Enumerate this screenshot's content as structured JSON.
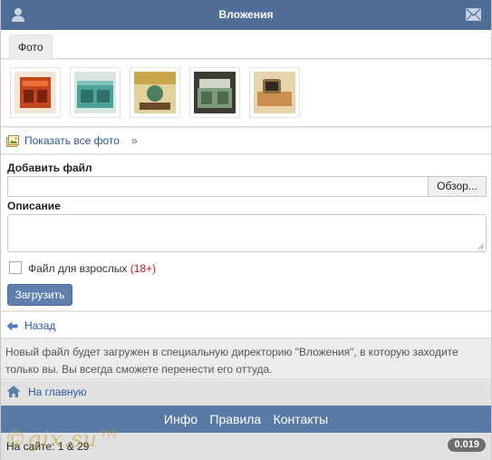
{
  "header": {
    "title": "Вложения",
    "left_icon": "user-icon",
    "right_icon": "mail-icon",
    "bg_color": "#4f6d97"
  },
  "tabs": [
    {
      "label": "Фото",
      "active": true
    }
  ],
  "thumbnails": [
    {
      "alt": "photo-1",
      "colors": [
        "#c4461f",
        "#e8743a"
      ]
    },
    {
      "alt": "photo-2",
      "colors": [
        "#4ba39a",
        "#7dc3bb"
      ]
    },
    {
      "alt": "photo-3",
      "colors": [
        "#c8a84a",
        "#4b7f60"
      ]
    },
    {
      "alt": "photo-4",
      "colors": [
        "#7c9c7c",
        "#cfd8c8"
      ]
    },
    {
      "alt": "photo-5",
      "colors": [
        "#c98f4c",
        "#e7d3ad"
      ]
    }
  ],
  "show_all": {
    "label": "Показать все фото",
    "suffix": "»"
  },
  "form": {
    "file_label": "Добавить файл",
    "browse_button": "Обзор...",
    "description_label": "Описание",
    "adult_label": "Файл для взрослых",
    "adult_badge": "(18+)",
    "adult_checked": false,
    "upload_button": "Загрузить"
  },
  "back": {
    "label": "Назад"
  },
  "info_text": "Новый файл будет загружен в специальную директорию \"Вложения\", в которую заходите только вы. Вы всегда сможете перенести его оттуда.",
  "home": {
    "label": "На главную"
  },
  "footer_nav": [
    {
      "label": "Инфо"
    },
    {
      "label": "Правила"
    },
    {
      "label": "Контакты"
    }
  ],
  "online": {
    "text": "На сайте: 1 & 29",
    "time": "0.019"
  },
  "watermark": "©gix.su™"
}
